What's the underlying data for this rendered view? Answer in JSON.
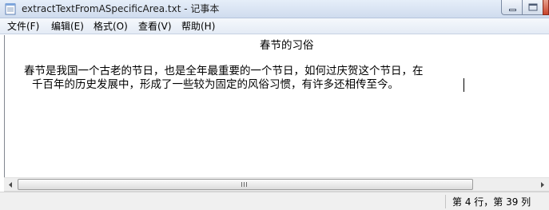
{
  "window": {
    "title": "extractTextFromASpecificArea.txt - 记事本"
  },
  "menu": [
    {
      "label": "文件(F)"
    },
    {
      "label": "编辑(E)"
    },
    {
      "label": "格式(O)"
    },
    {
      "label": "查看(V)"
    },
    {
      "label": "帮助(H)"
    }
  ],
  "document": {
    "lines": [
      "春节的习俗",
      "",
      "春节是我国一个古老的节日，也是全年最重要的一个节日，如何过庆贺这个节日，在",
      "千百年的历史发展中，形成了一些较为固定的风俗习惯，有许多还相传至今。"
    ]
  },
  "scrollbar": {
    "grip_glyph": "III"
  },
  "status": {
    "position": "第 4 行，第 39 列"
  },
  "icons": [
    "notepad-icon",
    "minimize-icon",
    "maximize-icon",
    "close-icon",
    "scroll-left-arrow-icon",
    "scroll-right-arrow-icon"
  ]
}
